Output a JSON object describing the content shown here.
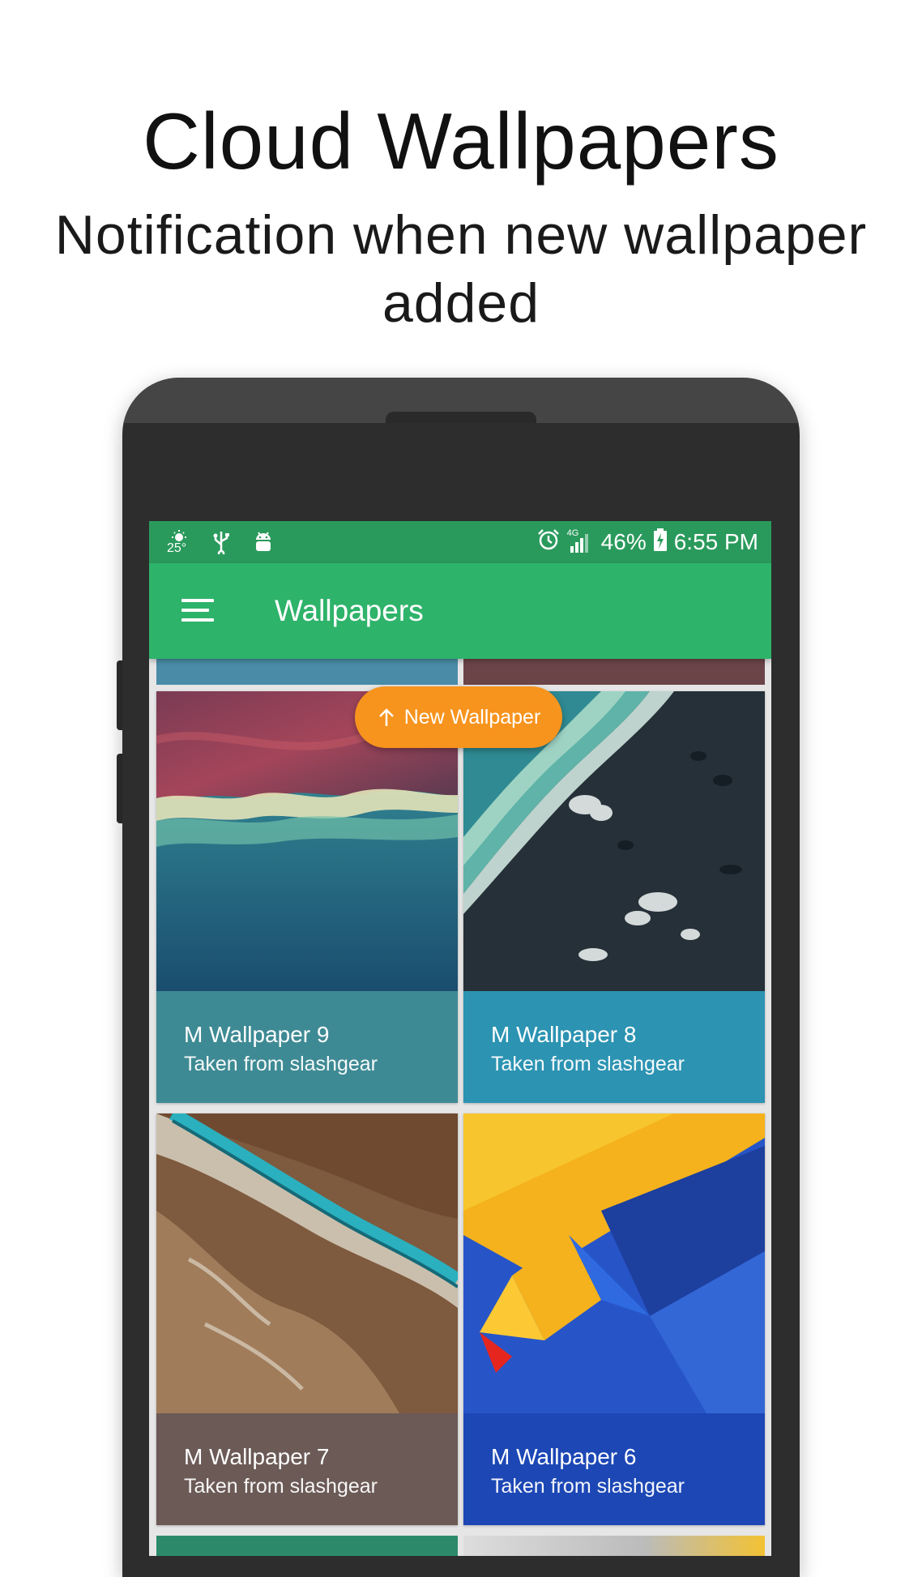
{
  "promo": {
    "headline": "Cloud Wallpapers",
    "subline": "Notification when new wallpaper added"
  },
  "status_bar": {
    "temperature": "25°",
    "network": "4G",
    "battery": "46%",
    "time": "6:55 PM",
    "icons": [
      "weather-sun-icon",
      "usb-icon",
      "android-debug-icon",
      "alarm-icon",
      "signal-icon",
      "battery-charging-icon"
    ]
  },
  "app_bar": {
    "title": "Wallpapers",
    "menu_icon": "menu-icon"
  },
  "new_wallpaper_pill": {
    "label": "New Wallpaper",
    "icon": "arrow-up-icon",
    "color": "#f7941d"
  },
  "wallpapers": [
    {
      "title": "M Wallpaper 9",
      "subtitle": "Taken from slashgear",
      "caption_color": "#3e8a94"
    },
    {
      "title": "M Wallpaper 8",
      "subtitle": "Taken from slashgear",
      "caption_color": "#2c93b2"
    },
    {
      "title": "M Wallpaper 7",
      "subtitle": "Taken from slashgear",
      "caption_color": "#6b5a56"
    },
    {
      "title": "M Wallpaper 6",
      "subtitle": "Taken from slashgear",
      "caption_color": "#1c47b5"
    }
  ],
  "colors": {
    "status_bar": "#2a9a5c",
    "app_bar": "#2eb36a"
  }
}
